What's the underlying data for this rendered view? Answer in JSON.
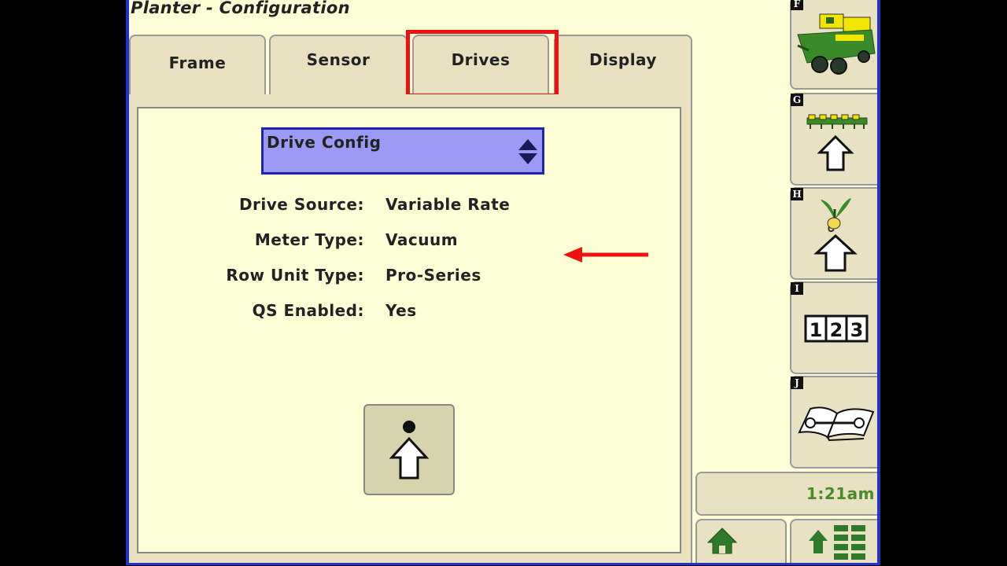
{
  "title": "Planter - Configuration",
  "tabs": [
    {
      "label": "Frame"
    },
    {
      "label": "Sensor"
    },
    {
      "label": "Drives",
      "selected": true
    },
    {
      "label": "Display"
    }
  ],
  "drive_select": {
    "value": "Drive Config"
  },
  "fields": [
    {
      "label": "Drive Source:",
      "value": "Variable Rate"
    },
    {
      "label": "Meter Type:",
      "value": "Vacuum"
    },
    {
      "label": "Row Unit Type:",
      "value": "Pro-Series"
    },
    {
      "label": "QS Enabled:",
      "value": "Yes"
    }
  ],
  "softkeys": [
    {
      "letter": "F",
      "icon": "planter-machine-icon"
    },
    {
      "letter": "G",
      "icon": "planter-toolbar-up-icon"
    },
    {
      "letter": "H",
      "icon": "seed-sprout-up-icon"
    },
    {
      "letter": "I",
      "icon": "number-123-icon"
    },
    {
      "letter": "J",
      "icon": "manual-book-wrench-icon"
    }
  ],
  "clock": "1:21am",
  "colors": {
    "screen_bg": "#fdfdd6",
    "tab_bg": "#e8e0bf",
    "select_bg": "#9b9bf5",
    "highlight_red": "#ee1111",
    "clock_green": "#4a8a2a",
    "frame_blue": "#2233cc"
  }
}
